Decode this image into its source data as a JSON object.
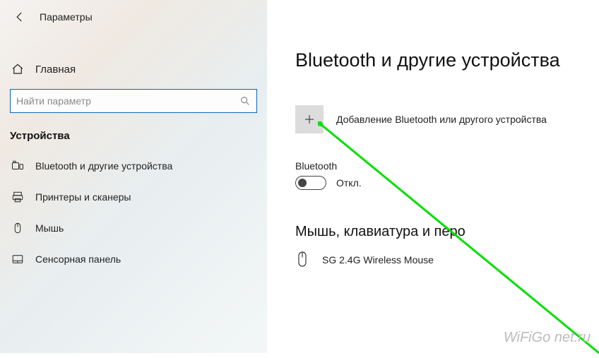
{
  "sidebar": {
    "header_title": "Параметры",
    "home_label": "Главная",
    "search_placeholder": "Найти параметр",
    "category_label": "Устройства",
    "items": [
      {
        "label": "Bluetooth и другие устройства",
        "icon": "devices"
      },
      {
        "label": "Принтеры и сканеры",
        "icon": "printer"
      },
      {
        "label": "Мышь",
        "icon": "mouse"
      },
      {
        "label": "Сенсорная панель",
        "icon": "touchpad"
      }
    ]
  },
  "main": {
    "title": "Bluetooth и другие устройства",
    "add_label": "Добавление Bluetooth или другого устройства",
    "bluetooth_label": "Bluetooth",
    "toggle_state": "Откл.",
    "devices_heading": "Мышь, клавиатура и перо",
    "device_name": "SG 2.4G Wireless Mouse"
  },
  "watermark": "WiFiGo net.ru"
}
